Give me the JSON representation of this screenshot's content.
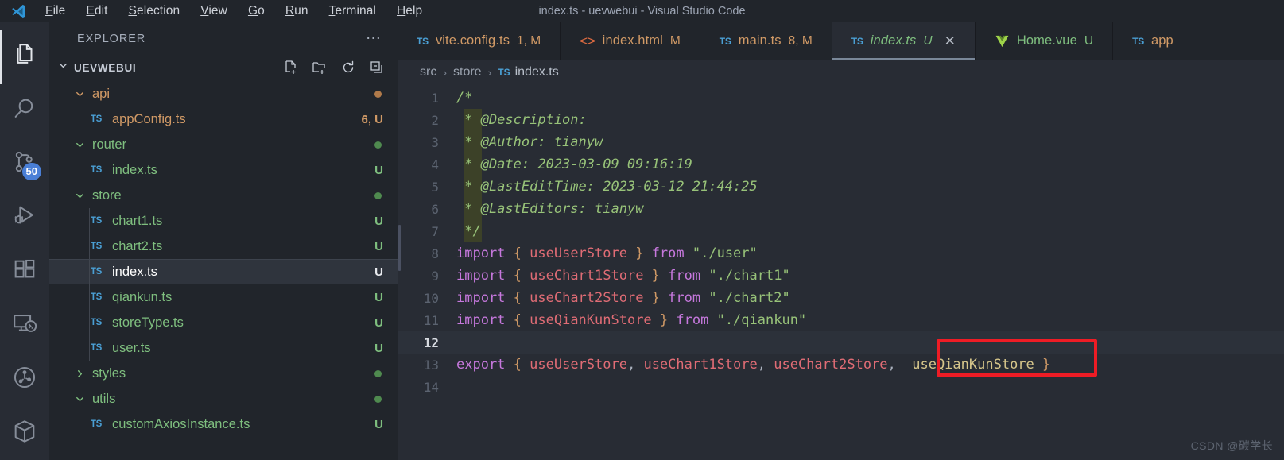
{
  "window": {
    "title": "index.ts - uevwebui - Visual Studio Code",
    "logo_icon": "vscode-logo-icon"
  },
  "menu": {
    "items": [
      {
        "label": "File",
        "mnemonic": "F",
        "rest": "ile"
      },
      {
        "label": "Edit",
        "mnemonic": "E",
        "rest": "dit"
      },
      {
        "label": "Selection",
        "mnemonic": "S",
        "rest": "election"
      },
      {
        "label": "View",
        "mnemonic": "V",
        "rest": "iew"
      },
      {
        "label": "Go",
        "mnemonic": "G",
        "rest": "o"
      },
      {
        "label": "Run",
        "mnemonic": "R",
        "rest": "un"
      },
      {
        "label": "Terminal",
        "mnemonic": "T",
        "rest": "erminal"
      },
      {
        "label": "Help",
        "mnemonic": "H",
        "rest": "elp"
      }
    ]
  },
  "activitybar": {
    "items": [
      {
        "name": "explorer",
        "icon": "files-icon",
        "active": true,
        "badge": ""
      },
      {
        "name": "search",
        "icon": "search-icon",
        "active": false,
        "badge": ""
      },
      {
        "name": "source-control",
        "icon": "source-control-icon",
        "active": false,
        "badge": "50"
      },
      {
        "name": "run-and-debug",
        "icon": "run-debug-icon",
        "active": false,
        "badge": ""
      },
      {
        "name": "extensions",
        "icon": "extensions-icon",
        "active": false,
        "badge": ""
      },
      {
        "name": "remote-explorer",
        "icon": "remote-explorer-icon",
        "active": false,
        "badge": ""
      },
      {
        "name": "graph",
        "icon": "graph-circle-icon",
        "active": false,
        "badge": ""
      },
      {
        "name": "package",
        "icon": "package-box-icon",
        "active": false,
        "badge": ""
      }
    ]
  },
  "sidebar": {
    "header_title": "EXPLORER",
    "more_actions_icon": "ellipsis-icon",
    "root": {
      "label": "UEVWEBUI",
      "expanded": true,
      "actions": [
        {
          "name": "new-file",
          "icon": "new-file-icon"
        },
        {
          "name": "new-folder",
          "icon": "new-folder-icon"
        },
        {
          "name": "refresh",
          "icon": "refresh-icon"
        },
        {
          "name": "collapse-all",
          "icon": "collapse-all-icon"
        }
      ]
    },
    "tree": [
      {
        "type": "folder",
        "label": "api",
        "indent": 1,
        "expanded": true,
        "color": "#d19a66",
        "badge_dot": "#b07a4a",
        "trail": "",
        "selected": false,
        "guide": false
      },
      {
        "type": "file",
        "label": "appConfig.ts",
        "indent": 2,
        "icon": "ts-icon",
        "color": "#d19a66",
        "badge_dot": "",
        "trail": "6, U",
        "selected": false,
        "guide": false
      },
      {
        "type": "folder",
        "label": "router",
        "indent": 1,
        "expanded": true,
        "color": "#7fbf7f",
        "badge_dot": "#4f8a4f",
        "trail": "",
        "selected": false,
        "guide": false
      },
      {
        "type": "file",
        "label": "index.ts",
        "indent": 2,
        "icon": "ts-icon",
        "color": "#7fbf7f",
        "badge_dot": "",
        "trail": "U",
        "selected": false,
        "guide": false
      },
      {
        "type": "folder",
        "label": "store",
        "indent": 1,
        "expanded": true,
        "color": "#7fbf7f",
        "badge_dot": "#4f8a4f",
        "trail": "",
        "selected": false,
        "guide": false
      },
      {
        "type": "file",
        "label": "chart1.ts",
        "indent": 2,
        "icon": "ts-icon",
        "color": "#7fbf7f",
        "badge_dot": "",
        "trail": "U",
        "selected": false,
        "guide": true
      },
      {
        "type": "file",
        "label": "chart2.ts",
        "indent": 2,
        "icon": "ts-icon",
        "color": "#7fbf7f",
        "badge_dot": "",
        "trail": "U",
        "selected": false,
        "guide": true
      },
      {
        "type": "file",
        "label": "index.ts",
        "indent": 2,
        "icon": "ts-icon",
        "color": "#ffffff",
        "badge_dot": "",
        "trail": "U",
        "selected": true,
        "guide": true
      },
      {
        "type": "file",
        "label": "qiankun.ts",
        "indent": 2,
        "icon": "ts-icon",
        "color": "#7fbf7f",
        "badge_dot": "",
        "trail": "U",
        "selected": false,
        "guide": true
      },
      {
        "type": "file",
        "label": "storeType.ts",
        "indent": 2,
        "icon": "ts-icon",
        "color": "#7fbf7f",
        "badge_dot": "",
        "trail": "U",
        "selected": false,
        "guide": true
      },
      {
        "type": "file",
        "label": "user.ts",
        "indent": 2,
        "icon": "ts-icon",
        "color": "#7fbf7f",
        "badge_dot": "",
        "trail": "U",
        "selected": false,
        "guide": true
      },
      {
        "type": "folder",
        "label": "styles",
        "indent": 1,
        "expanded": false,
        "color": "#7fbf7f",
        "badge_dot": "#4f8a4f",
        "trail": "",
        "selected": false,
        "guide": false
      },
      {
        "type": "folder",
        "label": "utils",
        "indent": 1,
        "expanded": true,
        "color": "#7fbf7f",
        "badge_dot": "#4f8a4f",
        "trail": "",
        "selected": false,
        "guide": false
      },
      {
        "type": "file",
        "label": "customAxiosInstance.ts",
        "indent": 2,
        "icon": "ts-icon",
        "color": "#7fbf7f",
        "badge_dot": "",
        "trail": "U",
        "selected": false,
        "guide": false
      }
    ]
  },
  "tabs": [
    {
      "label": "vite.config.ts",
      "status": "1, M",
      "icon": "ts-icon",
      "icon_color": "#4a9fd4",
      "color": "#d19a66",
      "active": false,
      "italic": false,
      "closable": false
    },
    {
      "label": "index.html",
      "status": "M",
      "icon": "html-icon",
      "icon_color": "#e06c42",
      "color": "#d19a66",
      "active": false,
      "italic": false,
      "closable": false
    },
    {
      "label": "main.ts",
      "status": "8, M",
      "icon": "ts-icon",
      "icon_color": "#4a9fd4",
      "color": "#d19a66",
      "active": false,
      "italic": false,
      "closable": false
    },
    {
      "label": "index.ts",
      "status": "U",
      "icon": "ts-icon",
      "icon_color": "#4a9fd4",
      "color": "#7fbf7f",
      "active": true,
      "italic": true,
      "closable": true
    },
    {
      "label": "Home.vue",
      "status": "U",
      "icon": "vue-icon",
      "icon_color": "#9fd44a",
      "color": "#7fbf7f",
      "active": false,
      "italic": false,
      "closable": false
    },
    {
      "label": "app",
      "status": "",
      "icon": "ts-icon",
      "icon_color": "#4a9fd4",
      "color": "#d19a66",
      "active": false,
      "italic": false,
      "closable": false
    }
  ],
  "tab_close_icon": "close-icon",
  "breadcrumb": {
    "parts": [
      "src",
      "store"
    ],
    "separator": "›",
    "file_icon": "ts-icon",
    "file": "index.ts"
  },
  "editor": {
    "active_line": 12,
    "lines": [
      {
        "n": 1,
        "tokens": [
          {
            "t": "/*",
            "c": "cmt"
          }
        ]
      },
      {
        "n": 2,
        "tokens": [
          {
            "t": " * @Description:",
            "c": "cmt"
          }
        ]
      },
      {
        "n": 3,
        "tokens": [
          {
            "t": " * @Author: tianyw",
            "c": "cmt"
          }
        ]
      },
      {
        "n": 4,
        "tokens": [
          {
            "t": " * @Date: 2023-03-09 09:16:19",
            "c": "cmt"
          }
        ]
      },
      {
        "n": 5,
        "tokens": [
          {
            "t": " * @LastEditTime: 2023-03-12 21:44:25",
            "c": "cmt"
          }
        ]
      },
      {
        "n": 6,
        "tokens": [
          {
            "t": " * @LastEditors: tianyw",
            "c": "cmt"
          }
        ]
      },
      {
        "n": 7,
        "tokens": [
          {
            "t": " */",
            "c": "cmt"
          }
        ]
      },
      {
        "n": 8,
        "tokens": [
          {
            "t": "import ",
            "c": "kw"
          },
          {
            "t": "{ ",
            "c": "br"
          },
          {
            "t": "useUserStore",
            "c": "id"
          },
          {
            "t": " }",
            "c": "br"
          },
          {
            "t": " from ",
            "c": "kw"
          },
          {
            "t": "\"./user\"",
            "c": "str"
          }
        ]
      },
      {
        "n": 9,
        "tokens": [
          {
            "t": "import ",
            "c": "kw"
          },
          {
            "t": "{ ",
            "c": "br"
          },
          {
            "t": "useChart1Store",
            "c": "id"
          },
          {
            "t": " }",
            "c": "br"
          },
          {
            "t": " from ",
            "c": "kw"
          },
          {
            "t": "\"./chart1\"",
            "c": "str"
          }
        ]
      },
      {
        "n": 10,
        "tokens": [
          {
            "t": "import ",
            "c": "kw"
          },
          {
            "t": "{ ",
            "c": "br"
          },
          {
            "t": "useChart2Store",
            "c": "id"
          },
          {
            "t": " }",
            "c": "br"
          },
          {
            "t": " from ",
            "c": "kw"
          },
          {
            "t": "\"./chart2\"",
            "c": "str"
          }
        ]
      },
      {
        "n": 11,
        "tokens": [
          {
            "t": "import ",
            "c": "kw"
          },
          {
            "t": "{ ",
            "c": "br"
          },
          {
            "t": "useQianKunStore",
            "c": "id"
          },
          {
            "t": " }",
            "c": "br"
          },
          {
            "t": " from ",
            "c": "kw"
          },
          {
            "t": "\"./qiankun\"",
            "c": "str"
          }
        ]
      },
      {
        "n": 12,
        "tokens": []
      },
      {
        "n": 13,
        "tokens": [
          {
            "t": "export ",
            "c": "kw"
          },
          {
            "t": "{ ",
            "c": "br"
          },
          {
            "t": "useUserStore",
            "c": "id"
          },
          {
            "t": ", ",
            "c": "plain"
          },
          {
            "t": "useChart1Store",
            "c": "id"
          },
          {
            "t": ", ",
            "c": "plain"
          },
          {
            "t": "useChart2Store",
            "c": "id"
          },
          {
            "t": ",  ",
            "c": "plain"
          },
          {
            "t": "useQianKunStore",
            "c": "unused"
          },
          {
            "t": " }",
            "c": "br"
          }
        ]
      },
      {
        "n": 14,
        "tokens": []
      }
    ],
    "annotation": {
      "name": "red-highlight-box",
      "color": "#ee1c25",
      "target": "useQianKunStore"
    }
  },
  "watermark": "CSDN @碳学长",
  "colors": {
    "titlebar_bg": "#21252b",
    "editor_bg": "#282c34",
    "accent_blue": "#4a7fd6",
    "annotation_red": "#ee1c25"
  }
}
